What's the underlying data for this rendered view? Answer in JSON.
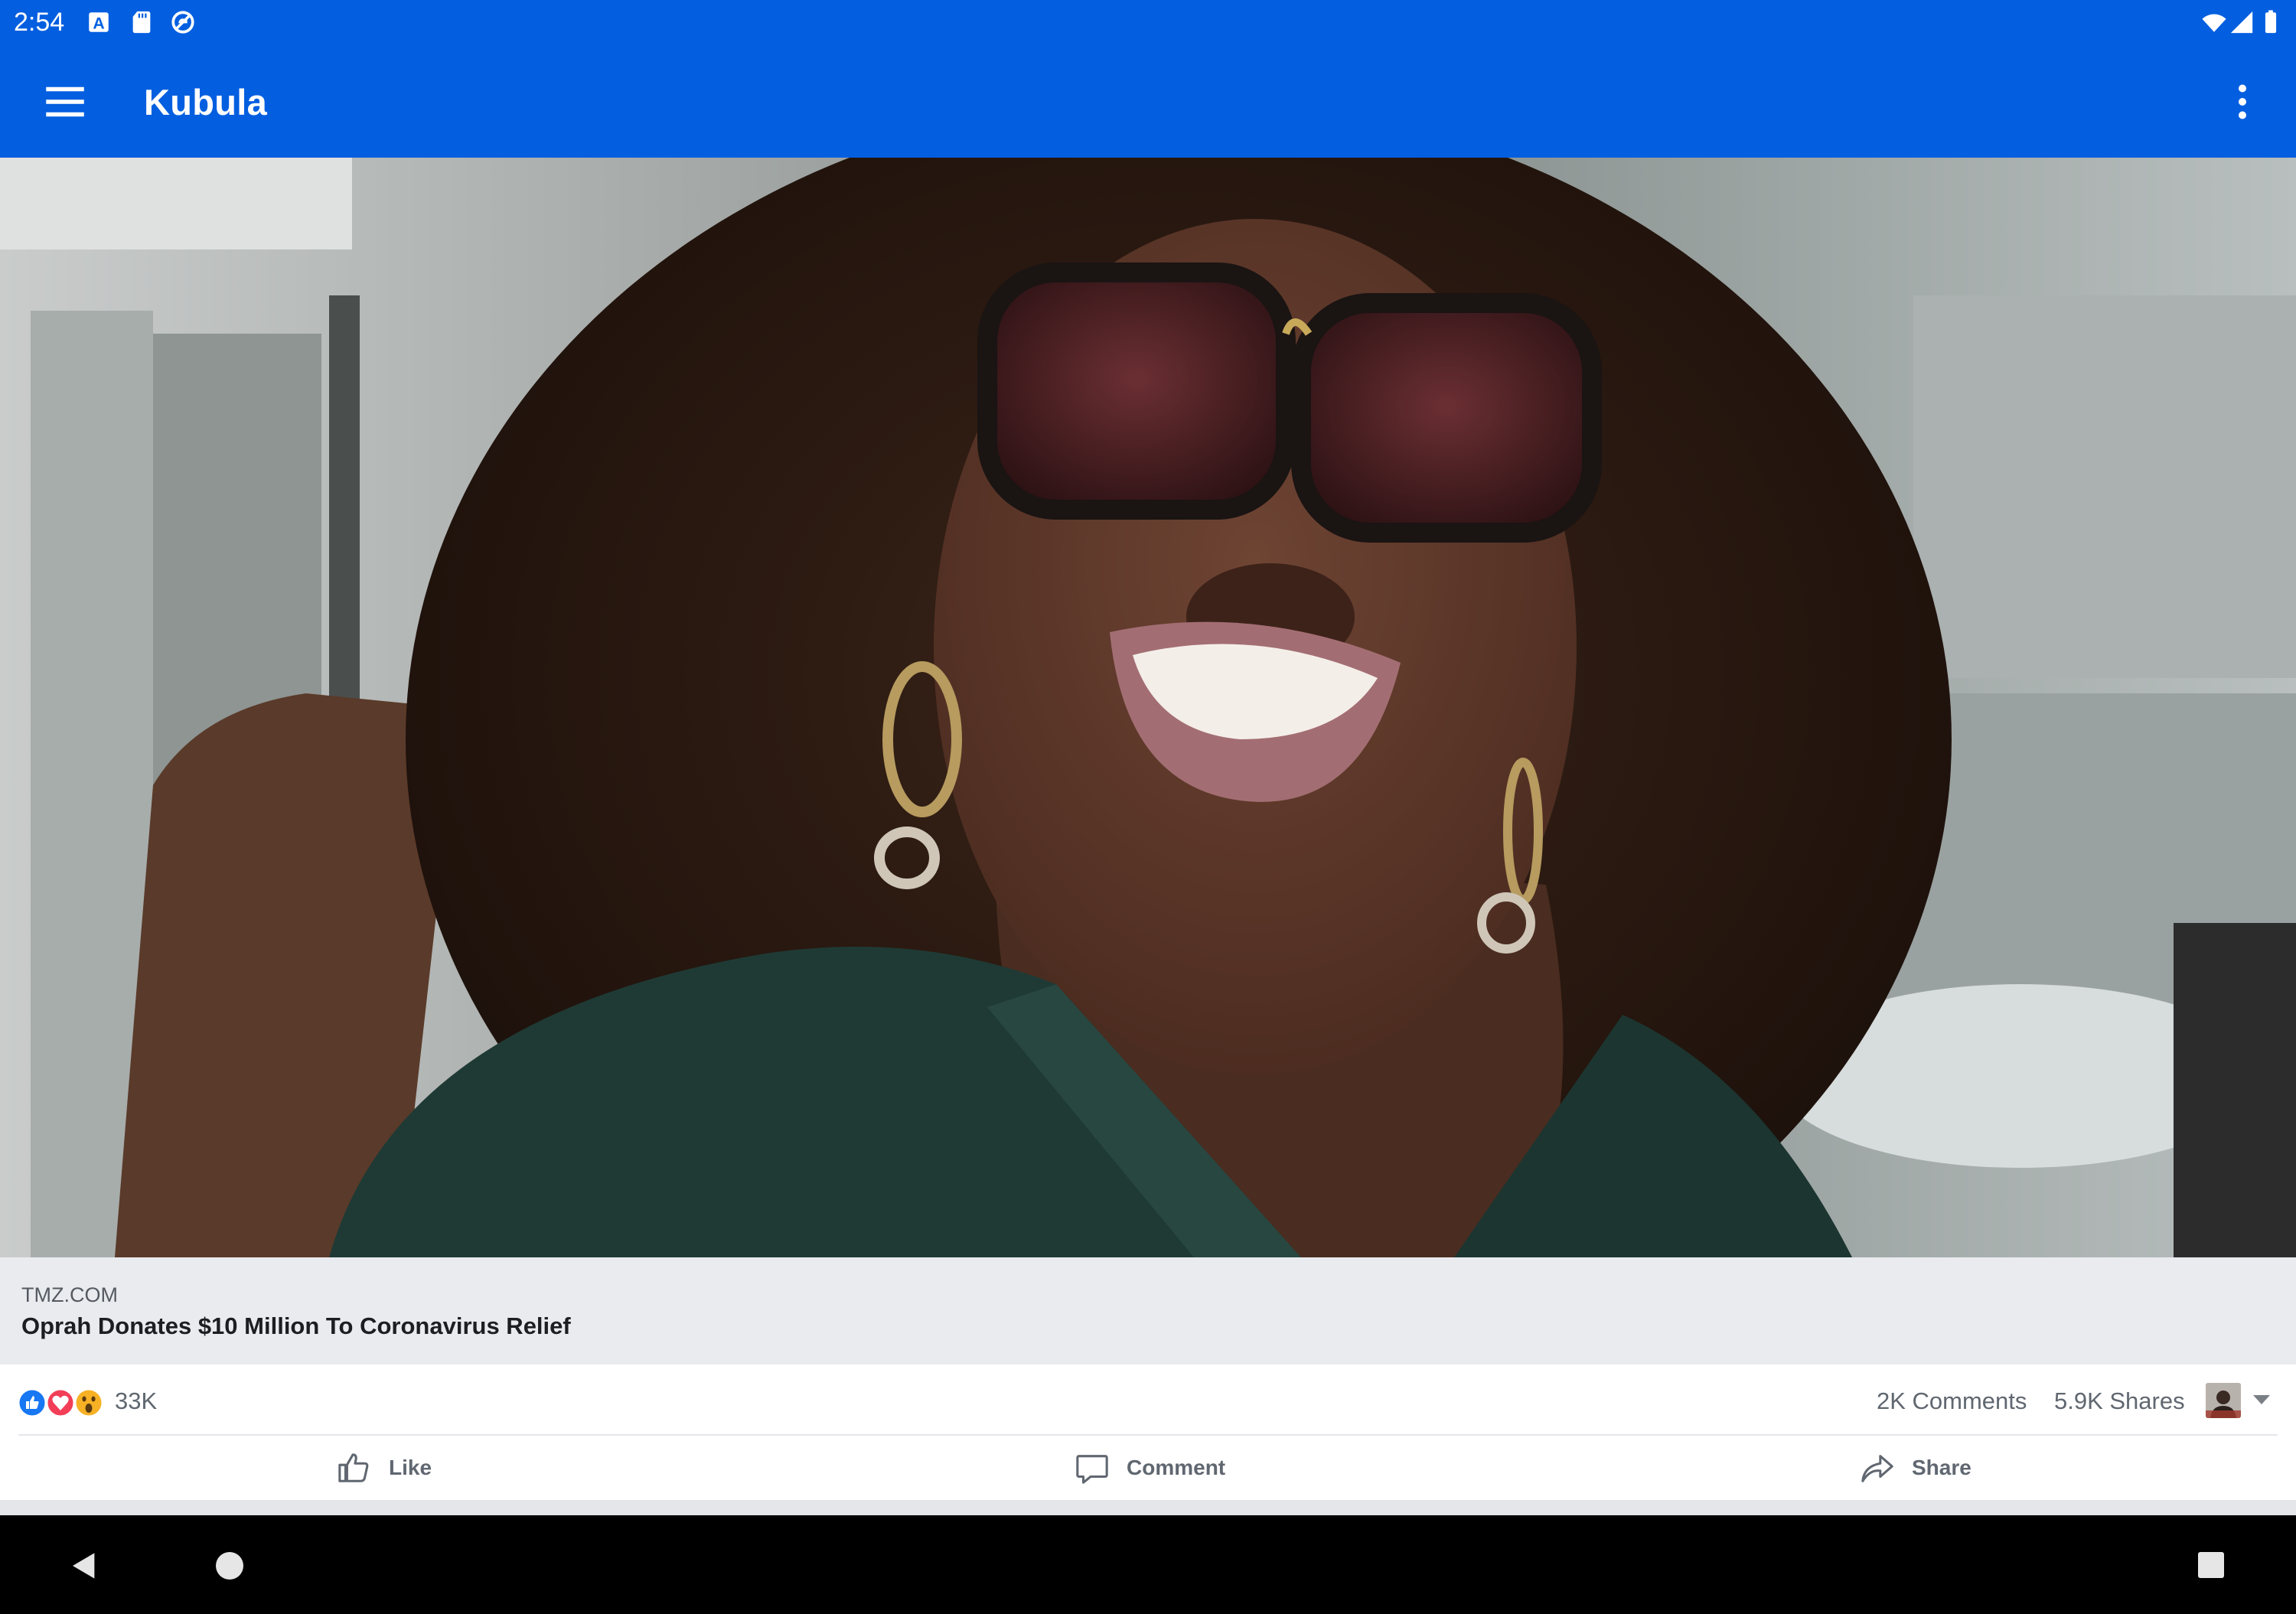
{
  "status_bar": {
    "time": "2:54",
    "left_icons": [
      "font-a-icon",
      "sd-card-icon",
      "sync-icon"
    ],
    "right_icons": [
      "wifi-icon",
      "signal-icon",
      "battery-icon"
    ]
  },
  "app_bar": {
    "title": "Kubula",
    "menu_icon": "hamburger-menu-icon",
    "overflow_icon": "more-vertical-icon",
    "background": "#045fe0"
  },
  "post": {
    "link_preview": {
      "domain": "TMZ.COM",
      "title": "Oprah Donates $10 Million To Coronavirus Relief"
    },
    "stats": {
      "reactions": [
        "like",
        "love",
        "wow"
      ],
      "reaction_count": "33K",
      "comments": "2K Comments",
      "shares": "5.9K Shares"
    },
    "actions": {
      "like": "Like",
      "comment": "Comment",
      "share": "Share"
    }
  },
  "nav_bar": {
    "icons": [
      "back-icon",
      "home-icon",
      "recents-icon"
    ]
  },
  "colors": {
    "accent": "#045fe0",
    "like_blue": "#1877f2",
    "love_red": "#f33e58",
    "wow_yellow": "#f7b125"
  }
}
